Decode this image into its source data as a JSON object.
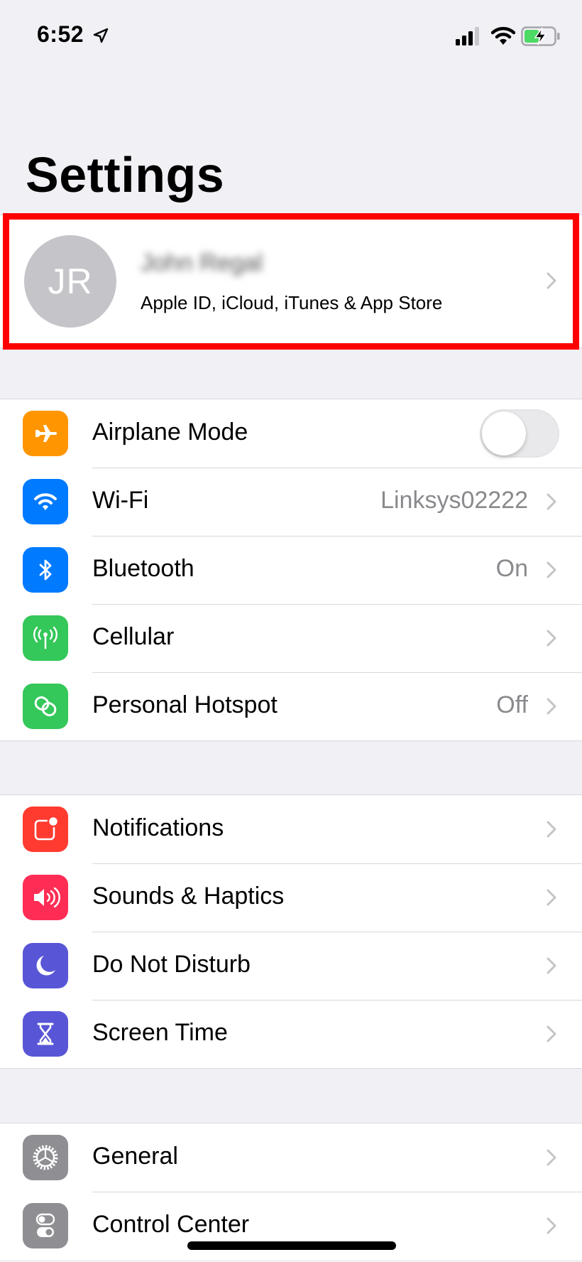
{
  "status_bar": {
    "time": "6:52",
    "icons": [
      "location-arrow-icon",
      "cellular-signal-icon",
      "wifi-icon",
      "battery-charging-icon"
    ],
    "battery_color": "#4cd964"
  },
  "header": {
    "title": "Settings"
  },
  "profile": {
    "initials": "JR",
    "name": "John Regal",
    "name_blurred": true,
    "subtitle": "Apple ID, iCloud, iTunes & App Store",
    "highlight_color": "#ff0000"
  },
  "groups": [
    {
      "items": [
        {
          "label": "Airplane Mode",
          "icon": "airplane-icon",
          "icon_color": "#ff9500",
          "control": "toggle",
          "toggle_on": false
        },
        {
          "label": "Wi-Fi",
          "icon": "wifi-icon",
          "icon_color": "#007aff",
          "value": "Linksys02222",
          "control": "chevron"
        },
        {
          "label": "Bluetooth",
          "icon": "bluetooth-icon",
          "icon_color": "#007aff",
          "value": "On",
          "control": "chevron"
        },
        {
          "label": "Cellular",
          "icon": "cellular-antenna-icon",
          "icon_color": "#34c759",
          "value": "",
          "control": "chevron"
        },
        {
          "label": "Personal Hotspot",
          "icon": "hotspot-link-icon",
          "icon_color": "#34c759",
          "value": "Off",
          "control": "chevron"
        }
      ]
    },
    {
      "items": [
        {
          "label": "Notifications",
          "icon": "notifications-icon",
          "icon_color": "#ff3b30",
          "control": "chevron"
        },
        {
          "label": "Sounds & Haptics",
          "icon": "speaker-icon",
          "icon_color": "#ff2d55",
          "control": "chevron"
        },
        {
          "label": "Do Not Disturb",
          "icon": "moon-icon",
          "icon_color": "#5856d6",
          "control": "chevron"
        },
        {
          "label": "Screen Time",
          "icon": "hourglass-icon",
          "icon_color": "#5856d6",
          "control": "chevron"
        }
      ]
    },
    {
      "items": [
        {
          "label": "General",
          "icon": "gear-icon",
          "icon_color": "#8e8e93",
          "control": "chevron"
        },
        {
          "label": "Control Center",
          "icon": "control-center-icon",
          "icon_color": "#8e8e93",
          "control": "chevron"
        }
      ]
    }
  ]
}
